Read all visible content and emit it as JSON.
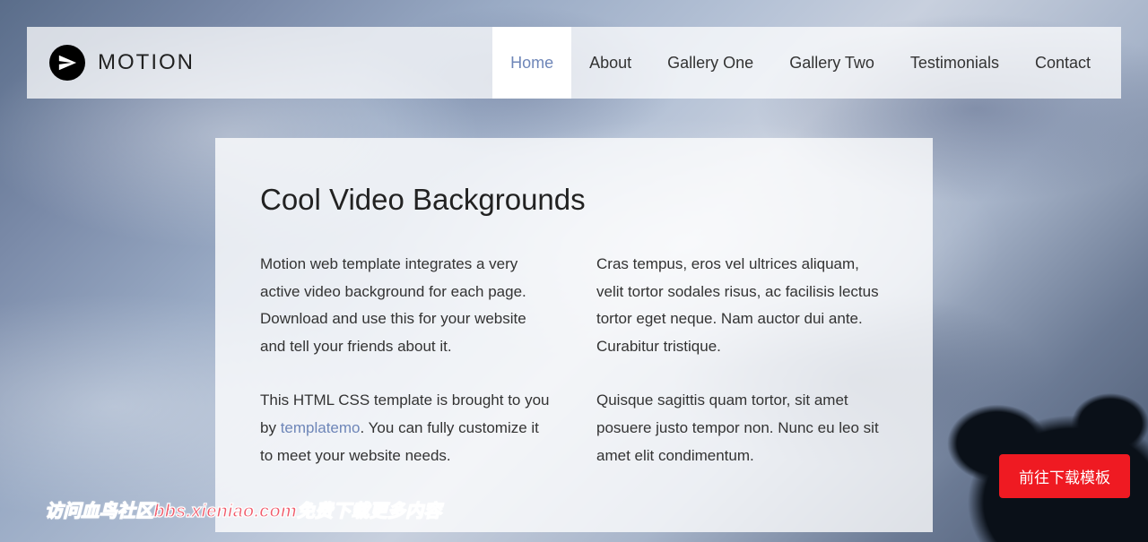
{
  "brand": {
    "text": "MOTION"
  },
  "nav": [
    {
      "label": "Home",
      "active": true
    },
    {
      "label": "About",
      "active": false
    },
    {
      "label": "Gallery One",
      "active": false
    },
    {
      "label": "Gallery Two",
      "active": false
    },
    {
      "label": "Testimonials",
      "active": false
    },
    {
      "label": "Contact",
      "active": false
    }
  ],
  "hero": {
    "title": "Cool Video Backgrounds",
    "left": {
      "p1": "Motion web template integrates a very active video background for each page. Download and use this for your website and tell your friends about it.",
      "p2_pre": "This HTML CSS template is brought to you by ",
      "p2_link": "templatemo",
      "p2_post": ". You can fully customize it to meet your website needs."
    },
    "right": {
      "p1": "Cras tempus, eros vel ultrices aliquam, velit tortor sodales risus, ac facilisis lectus tortor eget neque. Nam auctor dui ante. Curabitur tristique.",
      "p2": "Quisque sagittis quam tortor, sit amet posuere justo tempor non. Nunc eu leo sit amet elit condimentum."
    }
  },
  "download_button": "前往下载模板",
  "watermark": "访问血鸟社区bbs.xieniao.com免费下载更多内容"
}
